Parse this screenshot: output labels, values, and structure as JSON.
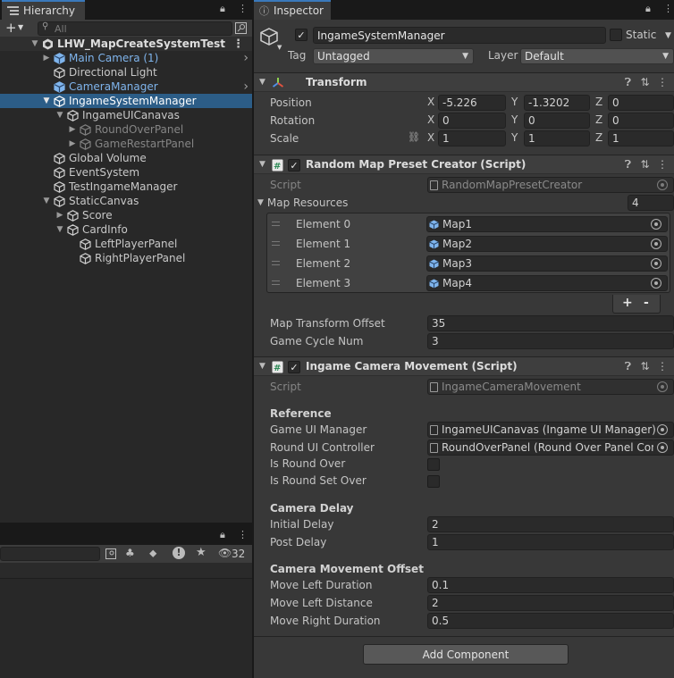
{
  "hierarchy": {
    "tab_label": "Hierarchy",
    "search_placeholder": "All",
    "scene_name": "LHW_MapCreateSystemTest",
    "items": [
      {
        "label": "Main Camera (1)"
      },
      {
        "label": "Directional Light"
      },
      {
        "label": "CameraManager"
      },
      {
        "label": "IngameSystemManager"
      },
      {
        "label": "IngameUICanavas"
      },
      {
        "label": "RoundOverPanel"
      },
      {
        "label": "GameRestartPanel"
      },
      {
        "label": "Global Volume"
      },
      {
        "label": "EventSystem"
      },
      {
        "label": "TestIngameManager"
      },
      {
        "label": "StaticCanvas"
      },
      {
        "label": "Score"
      },
      {
        "label": "CardInfo"
      },
      {
        "label": "LeftPlayerPanel"
      },
      {
        "label": "RightPlayerPanel"
      }
    ]
  },
  "bottom_panel": {
    "hidden_count": "32"
  },
  "inspector": {
    "tab_label": "Inspector",
    "object_name": "IngameSystemManager",
    "static_label": "Static",
    "tag_label": "Tag",
    "tag_value": "Untagged",
    "layer_label": "Layer",
    "layer_value": "Default",
    "transform": {
      "title": "Transform",
      "position_label": "Position",
      "rotation_label": "Rotation",
      "scale_label": "Scale",
      "axis_x": "X",
      "axis_y": "Y",
      "axis_z": "Z",
      "position": [
        "-5.226",
        "-1.3202",
        "0"
      ],
      "rotation": [
        "0",
        "0",
        "0"
      ],
      "scale": [
        "1",
        "1",
        "1"
      ]
    },
    "random_map": {
      "title": "Random Map Preset Creator (Script)",
      "script_label": "Script",
      "script_value": "RandomMapPresetCreator",
      "map_resources_label": "Map Resources",
      "map_resources_count": "4",
      "elements": [
        {
          "label": "Element 0",
          "value": "Map1"
        },
        {
          "label": "Element 1",
          "value": "Map2"
        },
        {
          "label": "Element 2",
          "value": "Map3"
        },
        {
          "label": "Element 3",
          "value": "Map4"
        }
      ],
      "add_label": "+",
      "remove_label": "-",
      "offset_label": "Map Transform Offset",
      "offset_value": "35",
      "cycle_label": "Game Cycle Num",
      "cycle_value": "3"
    },
    "camera_movement": {
      "title": "Ingame Camera Movement (Script)",
      "script_label": "Script",
      "script_value": "IngameCameraMovement",
      "reference_section": "Reference",
      "ui_manager_label": "Game UI Manager",
      "ui_manager_value": "IngameUICanavas (Ingame UI Manager)",
      "round_ui_label": "Round UI Controller",
      "round_ui_value": "RoundOverPanel (Round Over Panel Controller)",
      "is_round_over_label": "Is Round Over",
      "is_round_set_over_label": "Is Round Set Over",
      "delay_section": "Camera Delay",
      "initial_delay_label": "Initial Delay",
      "initial_delay_value": "2",
      "post_delay_label": "Post Delay",
      "post_delay_value": "1",
      "offset_section": "Camera Movement Offset",
      "move_left_duration_label": "Move Left Duration",
      "move_left_duration_value": "0.1",
      "move_left_distance_label": "Move Left Distance",
      "move_left_distance_value": "2",
      "move_right_duration_label": "Move Right Duration",
      "move_right_duration_value": "0.5"
    },
    "add_component_label": "Add Component"
  },
  "colors": {
    "selection": "#2c5d87",
    "prefab_blue": "#7fb4ec",
    "panel_bg": "#383838",
    "hierarchy_bg": "#282828"
  },
  "icons": [
    "hierarchy-icon",
    "lock-icon",
    "menu-icon",
    "plus-icon",
    "search-icon",
    "scene-icon",
    "cube-icon",
    "prefab-cube-icon",
    "inspector-icon",
    "transform-icon",
    "script-icon",
    "help-icon",
    "preset-icon",
    "kebab-icon",
    "object-picker-icon",
    "link-icon"
  ]
}
